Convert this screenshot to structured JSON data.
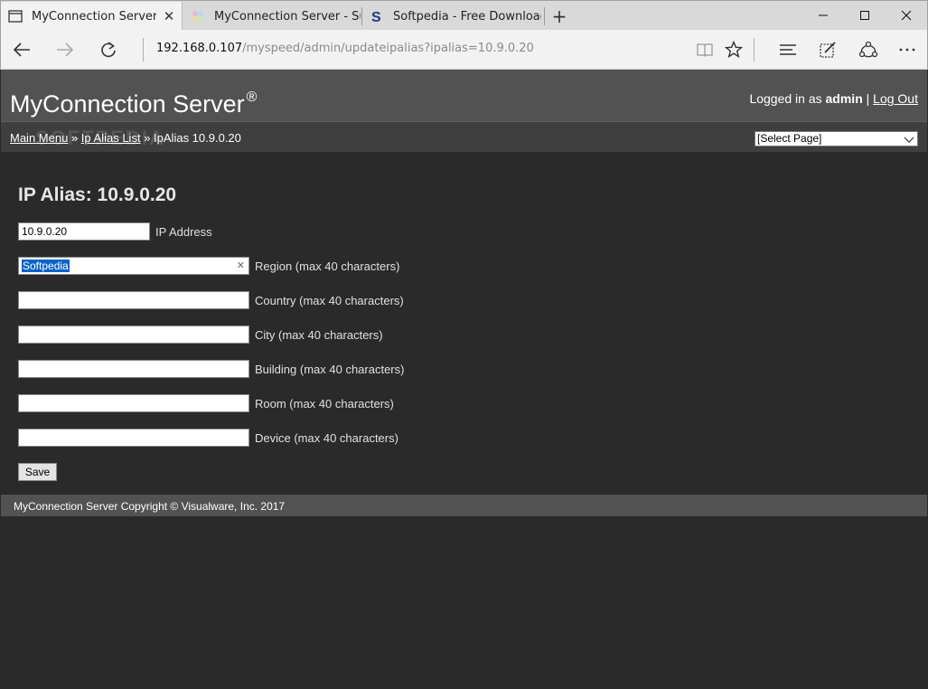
{
  "browser": {
    "tabs": [
      {
        "title": "MyConnection Server Ip",
        "icon": "page-icon",
        "active": true
      },
      {
        "title": "MyConnection Server - Sup",
        "icon": "pinwheel-icon",
        "active": false
      },
      {
        "title": "Softpedia - Free Downloads",
        "icon": "softpedia-s-icon",
        "active": false
      }
    ],
    "new_tab": "+",
    "address": {
      "host": "192.168.0.107",
      "path": "/myspeed/admin/updateipalias?ipalias=10.9.0.20"
    }
  },
  "header": {
    "title": "MyConnection Server",
    "registered": "®",
    "logged_in_prefix": "Logged in as",
    "user": "admin",
    "separator": "|",
    "logout": "Log Out"
  },
  "breadcrumb": {
    "main_menu": "Main Menu",
    "sep": "»",
    "ip_alias_list": "Ip Alias List",
    "current": "IpAlias 10.9.0.20"
  },
  "watermark": "SOFTPEDIA",
  "page_select": {
    "selected": "[Select Page]"
  },
  "form": {
    "heading": "IP Alias: 10.9.0.20",
    "fields": [
      {
        "value": "10.9.0.20",
        "label": "IP Address"
      },
      {
        "value": "Softpedia",
        "label": "Region (max 40 characters)"
      },
      {
        "value": "",
        "label": "Country (max 40 characters)"
      },
      {
        "value": "",
        "label": "City (max 40 characters)"
      },
      {
        "value": "",
        "label": "Building (max 40 characters)"
      },
      {
        "value": "",
        "label": "Room (max 40 characters)"
      },
      {
        "value": "",
        "label": "Device (max 40 characters)"
      }
    ],
    "save_label": "Save"
  },
  "footer": {
    "copyright": "MyConnection Server Copyright © Visualware, Inc. 2017"
  }
}
